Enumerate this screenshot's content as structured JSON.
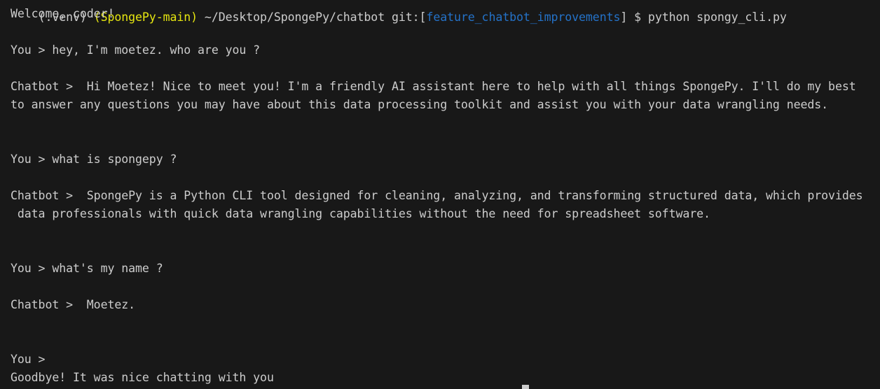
{
  "terminal": {
    "prompt_partial": {
      "parts": [
        {
          "text": "(.venv) ",
          "style": "seg-dim"
        },
        {
          "text": "(SpongePy-main)",
          "style": "seg-yellow"
        },
        {
          "text": " ~/Desktop/SpongePy/chatbot ",
          "style": "seg-dim"
        },
        {
          "text": "git:",
          "style": "seg-dim"
        },
        {
          "text": "[",
          "style": "seg-dim"
        },
        {
          "text": "feature_chatbot_improvements",
          "style": "seg-blue"
        },
        {
          "text": "] $ python spongy_cli.py",
          "style": "seg-dim"
        }
      ]
    },
    "lines": [
      "Welcome, coder!",
      "",
      "You > hey, I'm moetez. who are you ?",
      "",
      "Chatbot >  Hi Moetez! Nice to meet you! I'm a friendly AI assistant here to help with all things SpongePy. I'll do my best",
      "to answer any questions you may have about this data processing toolkit and assist you with your data wrangling needs.",
      "",
      "",
      "You > what is spongepy ?",
      "",
      "Chatbot >  SpongePy is a Python CLI tool designed for cleaning, analyzing, and transforming structured data, which provides",
      " data professionals with quick data wrangling capabilities without the need for spreadsheet software.",
      "",
      "",
      "You > what's my name ?",
      "",
      "Chatbot >  Moetez.",
      "",
      "",
      "You > ",
      "Goodbye! It was nice chatting with you"
    ]
  }
}
